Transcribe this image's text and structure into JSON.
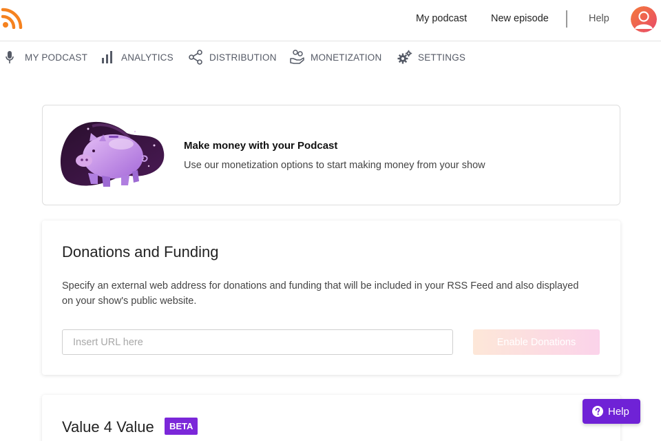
{
  "header": {
    "logo_icon": "rss-icon",
    "links": {
      "my_podcast": "My podcast",
      "new_episode": "New episode",
      "help": "Help"
    },
    "avatar_icon": "user-avatar-icon"
  },
  "nav": {
    "items": [
      {
        "label": "MY PODCAST",
        "icon": "microphone-icon"
      },
      {
        "label": "ANALYTICS",
        "icon": "bar-chart-icon"
      },
      {
        "label": "DISTRIBUTION",
        "icon": "share-icon"
      },
      {
        "label": "MONETIZATION",
        "icon": "hand-coins-icon"
      },
      {
        "label": "SETTINGS",
        "icon": "gears-icon"
      }
    ]
  },
  "promo": {
    "title": "Make money with your Podcast",
    "text": "Use our monetization options to start making money from your show",
    "illustration": "piggy-bank-illustration"
  },
  "donations": {
    "title": "Donations and Funding",
    "description": "Specify an external web address for donations and funding that will be included in your RSS Feed and also displayed on your show's public website.",
    "url_placeholder": "Insert URL here",
    "url_value": "",
    "button_label": "Enable Donations"
  },
  "value4value": {
    "title": "Value 4 Value",
    "badge": "BETA"
  },
  "help_fab": {
    "label": "Help",
    "icon": "question-circle-icon"
  },
  "colors": {
    "accent_purple": "#6f22d6",
    "beta_purple": "#7b27d9",
    "rss_orange": "#f5821f",
    "nav_text": "#555a66"
  }
}
